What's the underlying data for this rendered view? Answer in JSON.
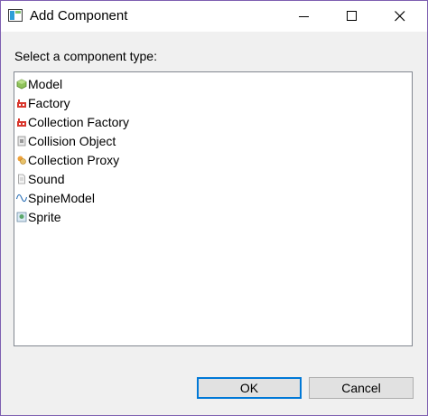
{
  "window": {
    "title": "Add Component",
    "accent": "#0078d7",
    "border_color": "#7e5fb1"
  },
  "prompt": "Select a component type:",
  "components": [
    {
      "label": "Model",
      "icon": "model-icon"
    },
    {
      "label": "Factory",
      "icon": "factory-icon"
    },
    {
      "label": "Collection Factory",
      "icon": "collection-factory-icon"
    },
    {
      "label": "Collision Object",
      "icon": "collision-object-icon"
    },
    {
      "label": "Collection Proxy",
      "icon": "collection-proxy-icon"
    },
    {
      "label": "Sound",
      "icon": "sound-icon"
    },
    {
      "label": "SpineModel",
      "icon": "spine-model-icon"
    },
    {
      "label": "Sprite",
      "icon": "sprite-icon"
    }
  ],
  "buttons": {
    "ok": "OK",
    "cancel": "Cancel"
  }
}
